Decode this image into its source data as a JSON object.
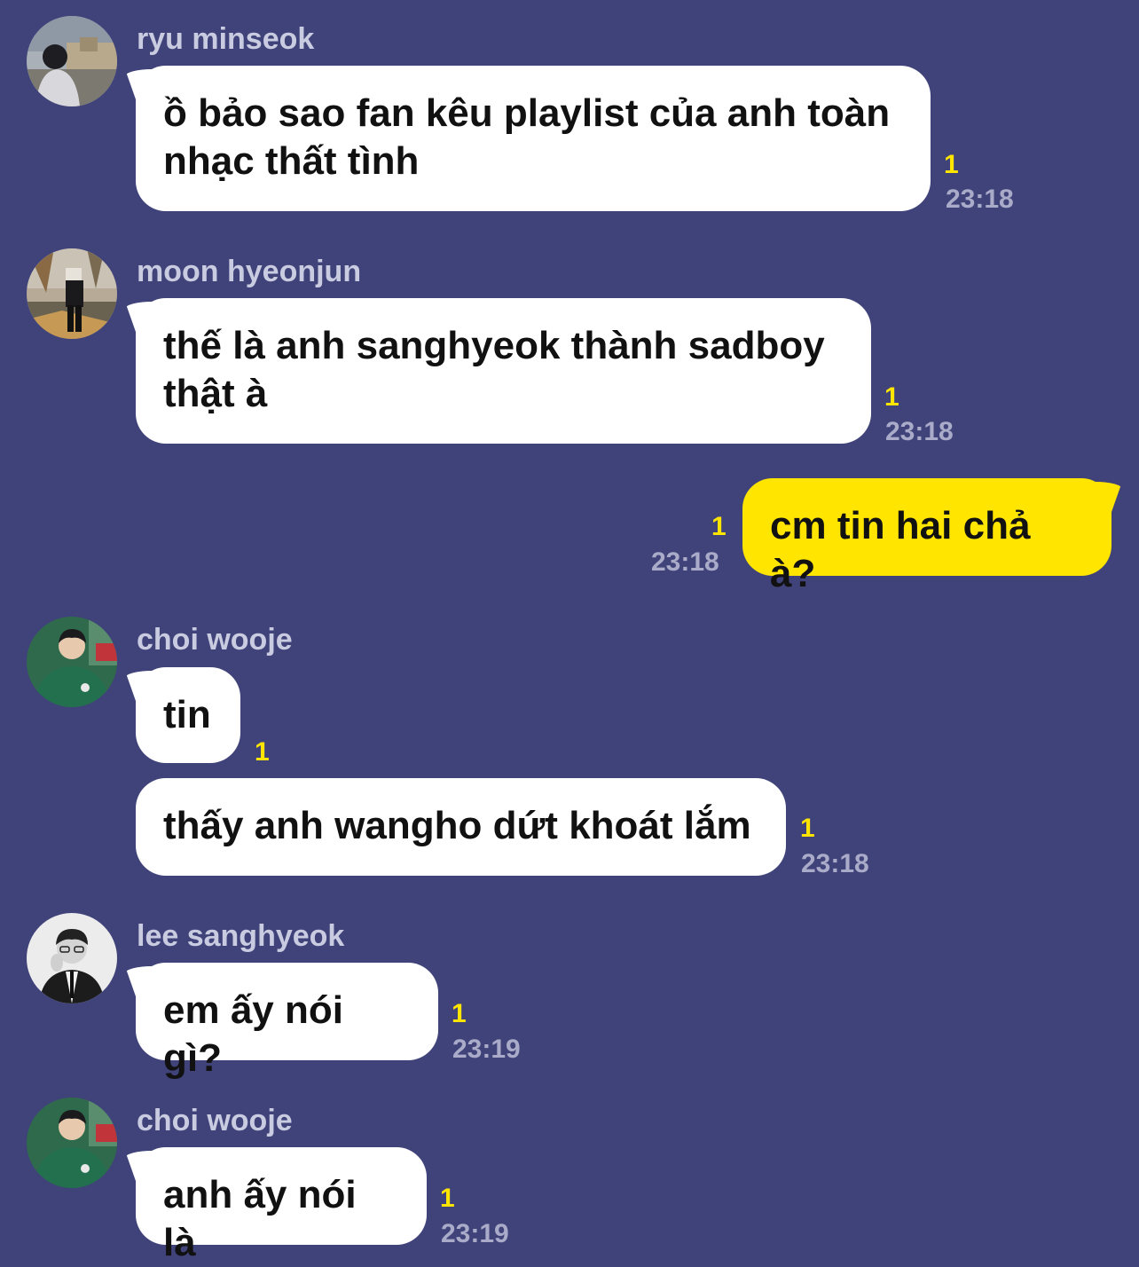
{
  "colors": {
    "background": "#40437a",
    "bubble_other": "#ffffff",
    "bubble_mine": "#ffe500",
    "unread_count": "#ffe500",
    "timestamp": "#a9abc8",
    "sender_name": "#c9cbe0"
  },
  "messages": [
    {
      "sender": "ryu minseok",
      "avatar_icon": "profile-photo-avatar",
      "text_line1": "ồ bảo sao fan kêu playlist của anh toàn",
      "text_line2": "nhạc thất tình",
      "unread": "1",
      "time": "23:18"
    },
    {
      "sender": "moon hyeonjun",
      "avatar_icon": "profile-photo-avatar",
      "text_line1": "thế là anh sanghyeok thành sadboy",
      "text_line2": "thật à",
      "unread": "1",
      "time": "23:18"
    },
    {
      "sender": "",
      "mine": true,
      "text": "cm tin hai chả à?",
      "unread": "1",
      "time": "23:18"
    },
    {
      "sender": "choi wooje",
      "avatar_icon": "profile-photo-avatar",
      "text": "tin",
      "unread": "1"
    },
    {
      "text": "thấy anh wangho dứt khoát lắm",
      "unread": "1",
      "time": "23:18"
    },
    {
      "sender": "lee sanghyeok",
      "avatar_icon": "profile-photo-avatar",
      "text": "em ấy nói gì?",
      "unread": "1",
      "time": "23:19"
    },
    {
      "sender": "choi wooje",
      "avatar_icon": "profile-photo-avatar",
      "text": "anh ấy nói là",
      "unread": "1",
      "time": "23:19"
    }
  ]
}
